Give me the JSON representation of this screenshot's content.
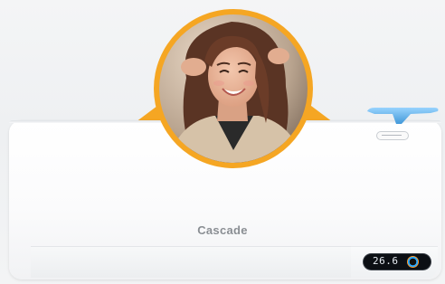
{
  "product": {
    "brand": "Cascade",
    "display_reading": "26.6",
    "badge_text": ""
  },
  "colors": {
    "accent_ring": "#f5a623",
    "unit_body": "#ffffff",
    "display_bg": "#0c0f14",
    "wifi_blue": "#4aa8ea"
  },
  "image": {
    "subject": "smiling-woman-portrait"
  }
}
